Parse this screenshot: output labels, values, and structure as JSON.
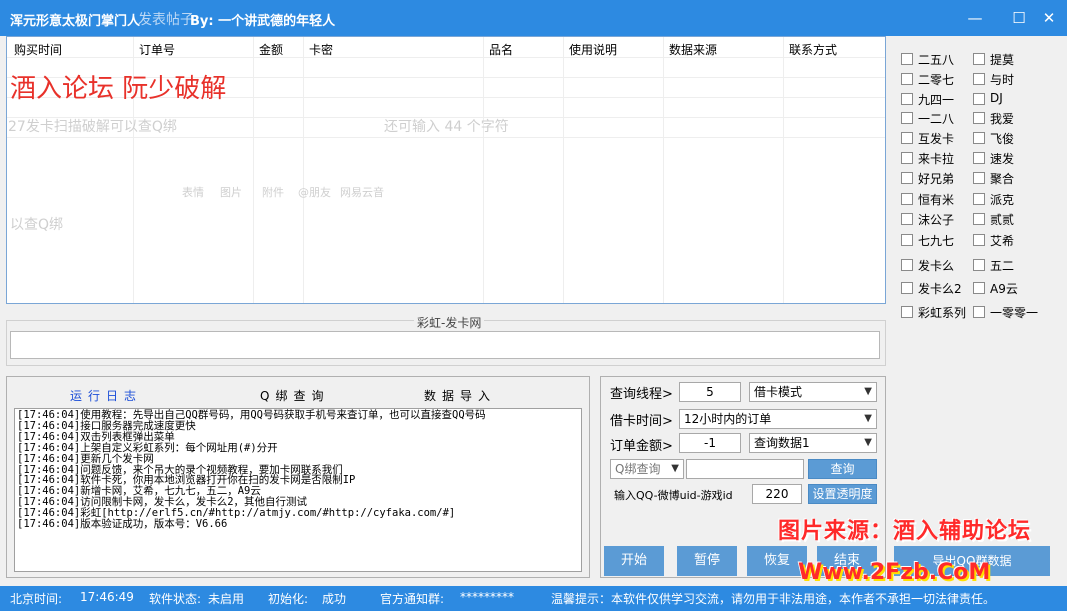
{
  "window": {
    "title": "浑元形意太极门掌门人",
    "ghost_title": "发表帖子",
    "byline": "By:  一个讲武德的年轻人",
    "min_glyph": "—",
    "max_glyph": "☐",
    "close_glyph": "✕"
  },
  "table": {
    "columns": [
      "购买时间",
      "订单号",
      "金额",
      "卡密",
      "品名",
      "使用说明",
      "数据来源",
      "联系方式"
    ]
  },
  "overlay": {
    "red_text": "酒入论坛 阮少破解",
    "ghost_input": "27发卡扫描破解可以查Q绑",
    "ghost_counter": "还可输入 44 个字符",
    "ghost_bottom": "以查Q绑",
    "ghost_toolbar": [
      "表情",
      "图片",
      "附件",
      "@朋友",
      "网易云音"
    ]
  },
  "sites": {
    "left": [
      "二五八",
      "二零七",
      "九四一",
      "一二八",
      "互发卡",
      "来卡拉",
      "好兄弟",
      "恒有米",
      "沫公子",
      "七九七",
      "发卡么",
      "发卡么2",
      "彩虹系列"
    ],
    "right": [
      "提莫",
      "与时",
      "DJ",
      "我爱",
      "飞俊",
      "速发",
      "聚合",
      "派克",
      "贰贰",
      "艾希",
      "五二",
      "A9云",
      "一零零一"
    ]
  },
  "rainbow": {
    "title": "彩虹-发卡网",
    "value": ""
  },
  "log": {
    "tabs": [
      "运行日志",
      "Q绑查询",
      "数据导入"
    ],
    "lines": [
      "[17:46:04]使用教程：先导出自己QQ群号码，用QQ号码获取手机号来查订单，也可以直接查QQ号码",
      "[17:46:04]接口服务器完成速度更快",
      "[17:46:04]双击列表框弹出菜单",
      "[17:46:04]上架自定义彩虹系列：每个网址用(#)分开",
      "[17:46:04]更新几个发卡网",
      "[17:46:04]问题反馈，来个吊大的录个视频教程，要加卡网联系我们",
      "[17:46:04]软件卡死，你用本地浏览器打开你在扫的发卡网是否限制IP",
      "[17:46:04]新增卡网，艾希，七九七，五二，A9云",
      "[17:46:04]访问限制卡网，发卡么，发卡么2，其他自行测试",
      "[17:46:04]彩虹[http://erlf5.cn/#http://atmjy.com/#http://cyfaka.com/#]",
      "[17:46:04]版本验证成功，版本号：V6.66"
    ]
  },
  "controls": {
    "threads_label": "查询线程>",
    "threads_value": "5",
    "mode_select": "借卡模式",
    "time_label": "借卡时间>",
    "time_select": "12小时内的订单",
    "amount_label": "订单金额>",
    "amount_value": "-1",
    "data_select": "查询数据1",
    "qbind_select": "Q绑查询",
    "query_input": "",
    "query_button": "查询",
    "uid_label": "输入QQ-微博uid-游戏id",
    "uid_value": "220",
    "transparency_button": "设置透明度",
    "buttons": [
      "开始",
      "暂停",
      "恢复",
      "结束",
      "导出QQ群数据"
    ]
  },
  "status": {
    "time_label": "北京时间:",
    "time_value": "17:46:49",
    "software_label": "软件状态:",
    "software_value": "未启用",
    "init_label": "初始化:",
    "init_value": "成功",
    "group_label": "官方通知群:",
    "group_value": "*********",
    "tip": "温馨提示：本软件仅供学习交流，请勿用于非法用途，本作者不承担一切法律责任。"
  },
  "watermark": {
    "line1": "图片来源：酒入辅助论坛",
    "line2": "Www.2Fzb.CoM"
  },
  "colors": {
    "titlebar": "#2d8ae1",
    "button": "#5b9bd5",
    "accent_red": "#e8312a"
  }
}
